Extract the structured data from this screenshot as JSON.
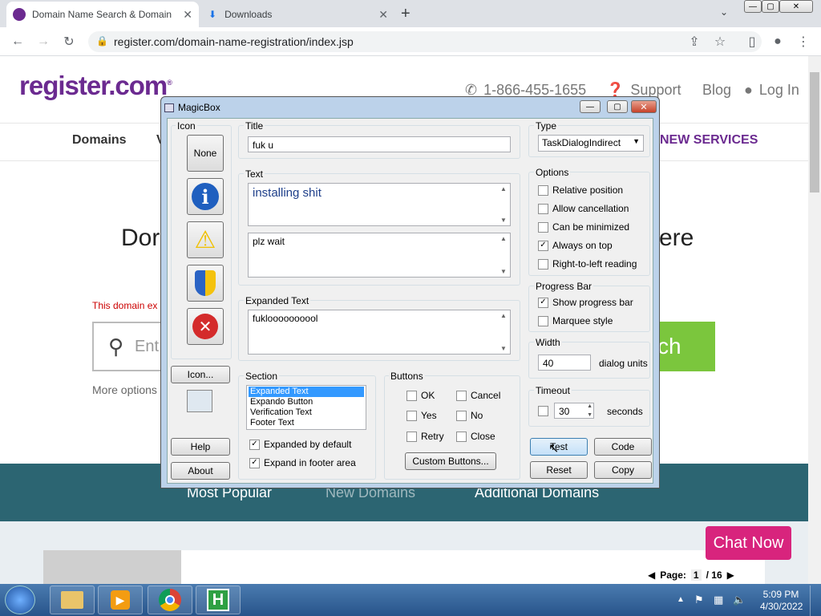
{
  "browser": {
    "tabs": [
      {
        "title": "Domain Name Search & Domain",
        "active": true
      },
      {
        "title": "Downloads",
        "active": false
      }
    ],
    "new_tab": "+",
    "url": "register.com/domain-name-registration/index.jsp",
    "window_controls": {
      "min": "—",
      "max": "▢",
      "close": "✕"
    }
  },
  "site": {
    "logo": "register.com",
    "logo_mark": "®",
    "phone": "1-866-455-1655",
    "support": "Support",
    "blog": "Blog",
    "login": "Log In",
    "nav": {
      "domains": "Domains",
      "v_partial": "V",
      "new_services": "NEW SERVICES"
    },
    "headline_left": "Dor",
    "headline_right": "ere",
    "domain_note": "This domain ex",
    "search_placeholder": "Ent",
    "search_button": "ch",
    "more_options": "More options",
    "tabs": {
      "popular": "Most Popular",
      "new": "New Domains",
      "additional": "Additional Domains"
    },
    "chat": "Chat Now",
    "pager": {
      "label": "Page:",
      "current": "1",
      "total": "/ 16"
    }
  },
  "dialog": {
    "title": "MagicBox",
    "icon_group": "Icon",
    "icon_none": "None",
    "icon_button": "Icon...",
    "help": "Help",
    "about": "About",
    "title_group": "Title",
    "title_value": "fuk u",
    "text_group": "Text",
    "main_text": "installing shit",
    "content_text": "plz wait",
    "expanded_group": "Expanded Text",
    "expanded_text": "fukloooooooool",
    "section_group": "Section",
    "section_items": [
      "Expanded Text",
      "Expando Button",
      "Verification Text",
      "Footer Text"
    ],
    "section_selected": "Expanded Text",
    "expanded_default": "Expanded by default",
    "expand_footer": "Expand in footer area",
    "buttons_group": "Buttons",
    "btn_ok": "OK",
    "btn_cancel": "Cancel",
    "btn_yes": "Yes",
    "btn_no": "No",
    "btn_retry": "Retry",
    "btn_close": "Close",
    "custom_buttons": "Custom Buttons...",
    "type_group": "Type",
    "type_value": "TaskDialogIndirect",
    "options_group": "Options",
    "opt_relative": "Relative position",
    "opt_cancel": "Allow cancellation",
    "opt_minimize": "Can be minimized",
    "opt_ontop": "Always on top",
    "opt_rtl": "Right-to-left reading",
    "progress_group": "Progress Bar",
    "show_progress": "Show progress bar",
    "marquee": "Marquee style",
    "width_group": "Width",
    "width_value": "40",
    "width_unit": "dialog units",
    "timeout_group": "Timeout",
    "timeout_value": "30",
    "timeout_unit": "seconds",
    "test": "Test",
    "code": "Code",
    "reset": "Reset",
    "copy": "Copy",
    "checks": {
      "ontop": true,
      "show_progress": true,
      "expanded_default": true,
      "expand_footer": true
    }
  },
  "taskbar": {
    "time": "5:09 PM",
    "date": "4/30/2022"
  },
  "colors": {
    "brand": "#6b2a90",
    "teal": "#2c6572",
    "chat": "#d8247d",
    "search_green": "#7bc63d"
  }
}
